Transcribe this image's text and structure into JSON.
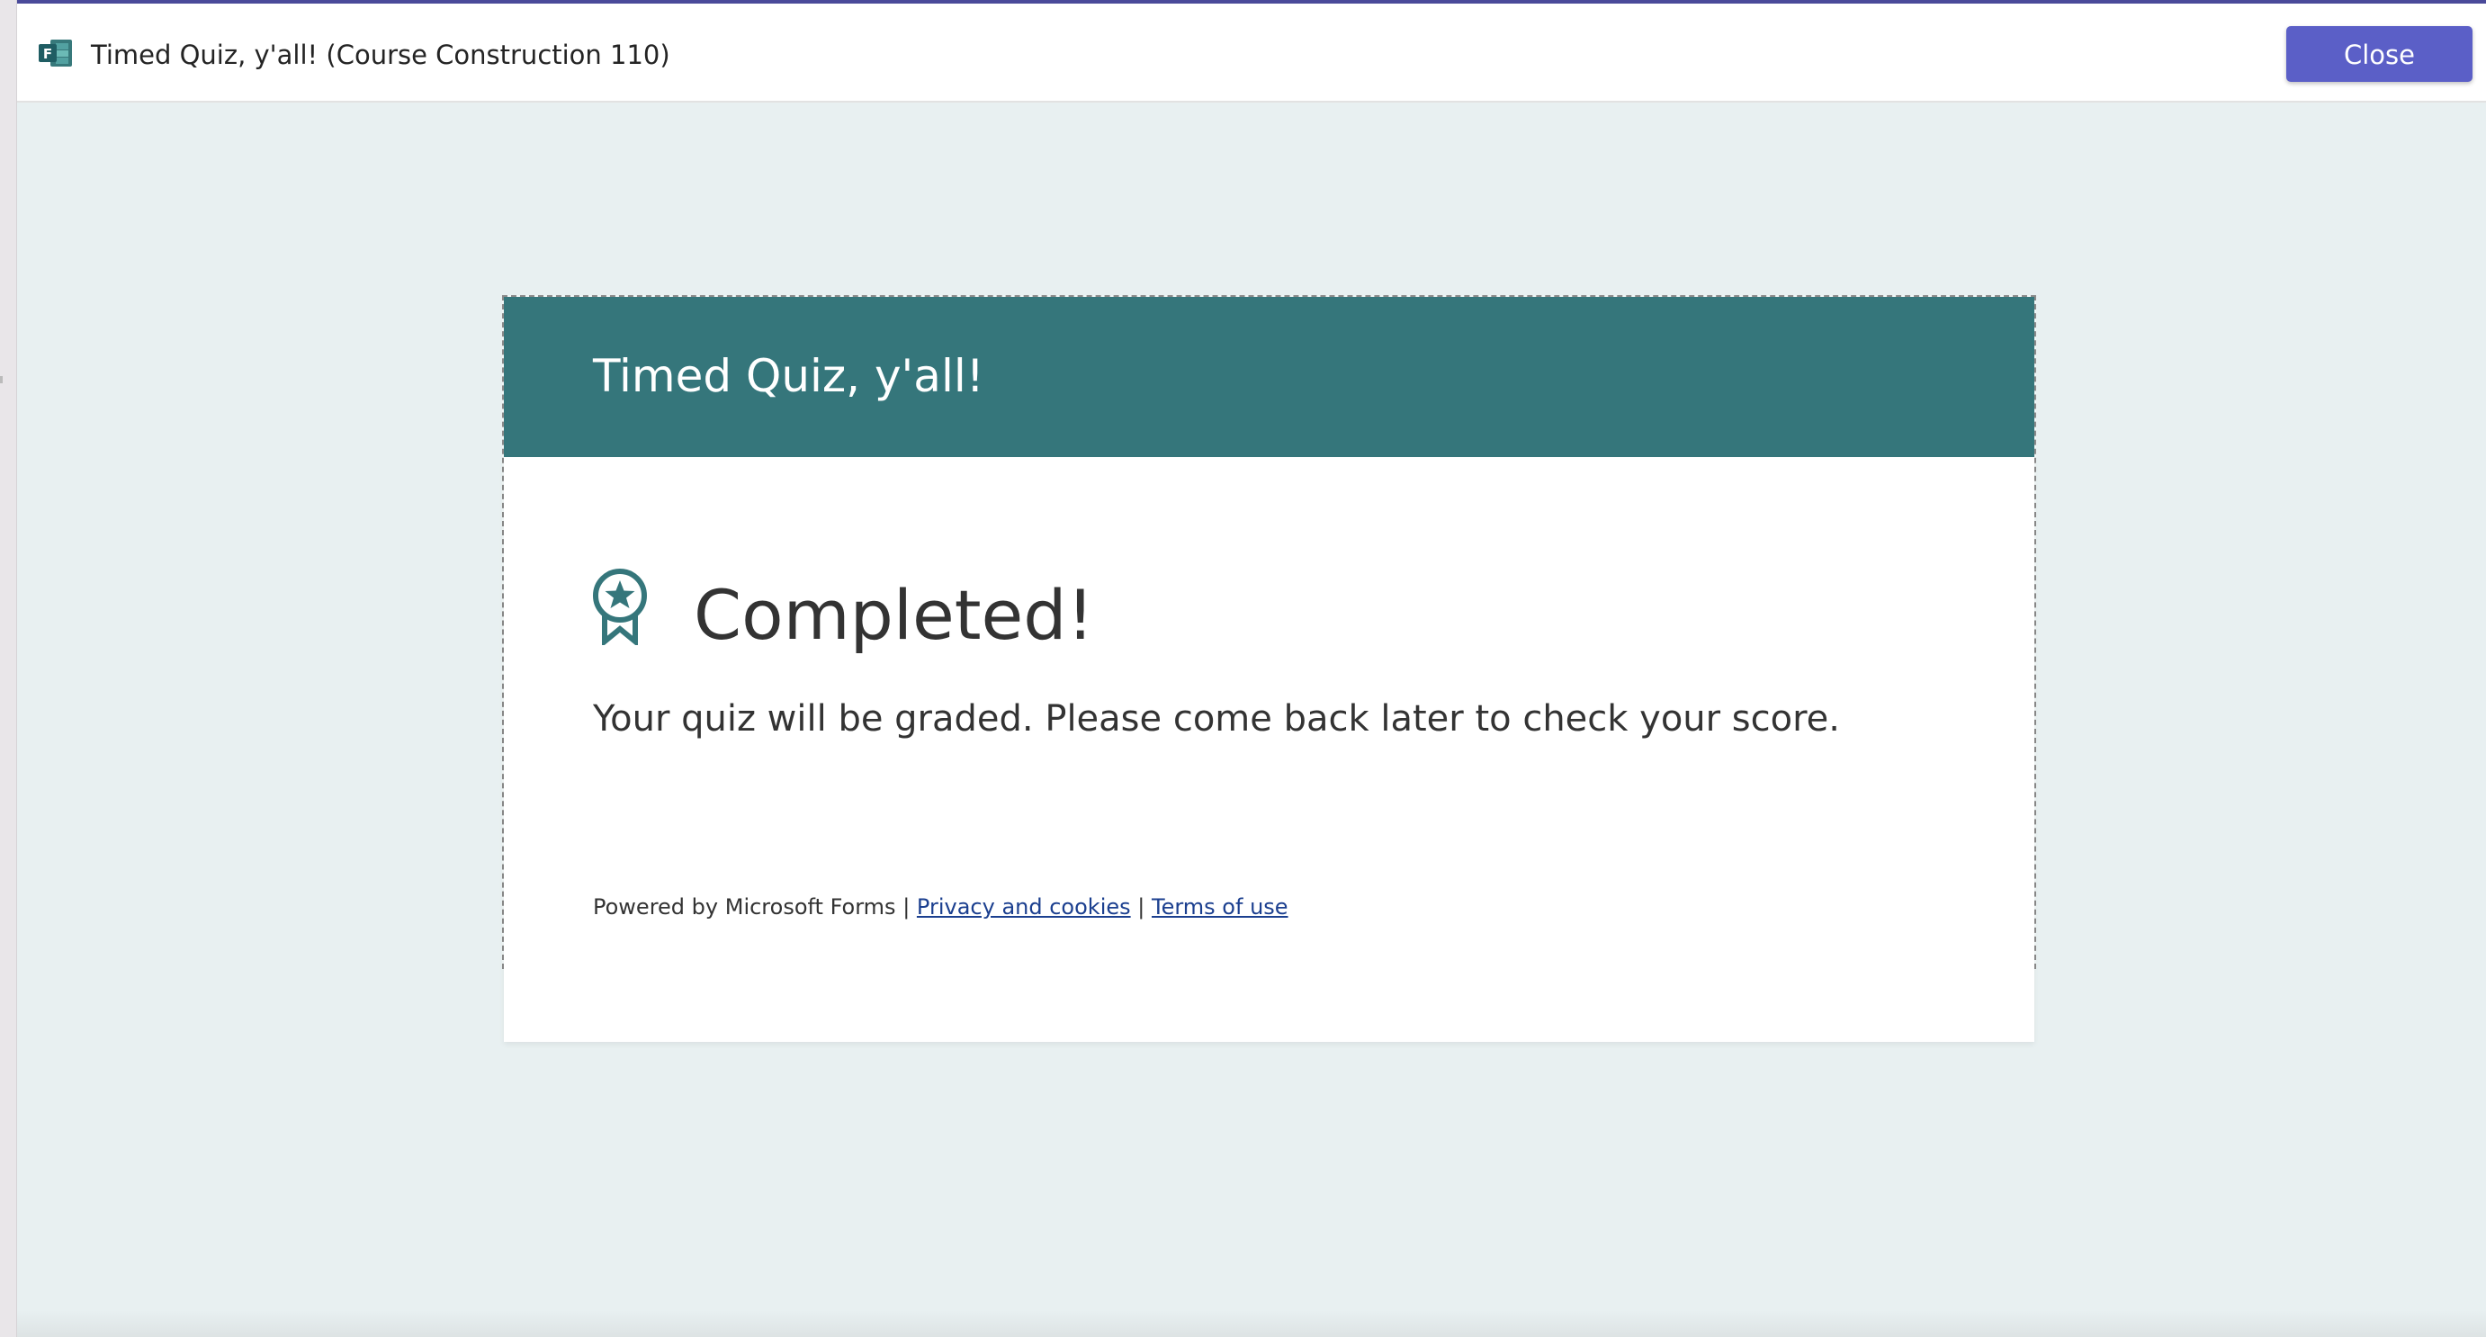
{
  "window": {
    "title": "Timed Quiz, y'all! (Course Construction 110)",
    "app_icon": "microsoft-forms-icon",
    "close_label": "Close",
    "accent_color": "#5b5fc7"
  },
  "card": {
    "header_title": "Timed Quiz, y'all!",
    "header_color": "#35767b",
    "status_icon": "award-ribbon-icon",
    "status_title": "Completed!",
    "message": "Your quiz will be graded. Please come back later to check your score."
  },
  "footer": {
    "powered_by": "Powered by Microsoft Forms",
    "separator": "|",
    "privacy_label": "Privacy and cookies",
    "terms_label": "Terms of use"
  }
}
